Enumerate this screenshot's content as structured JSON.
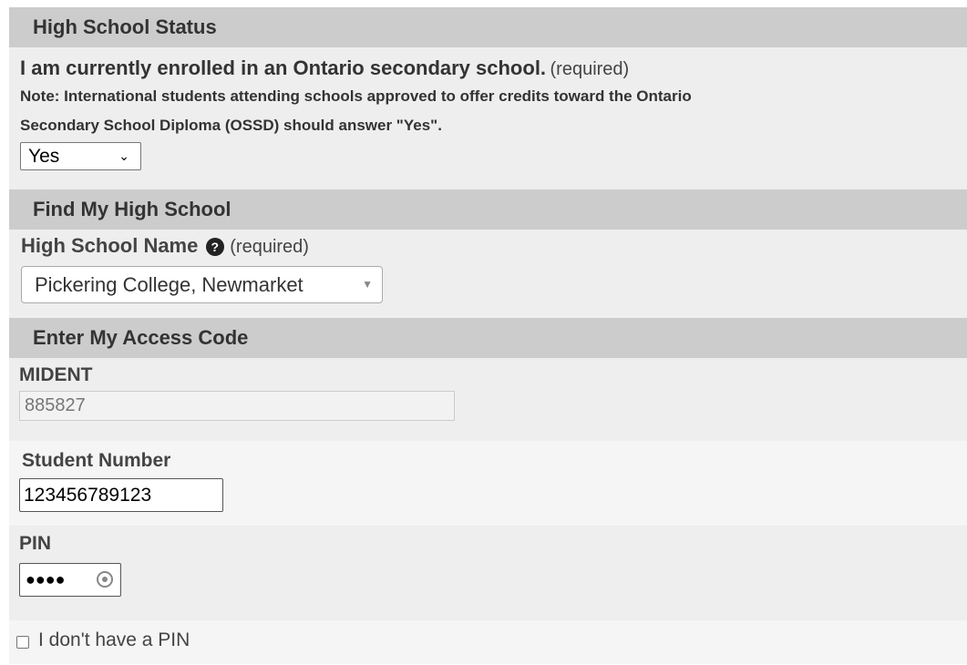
{
  "high_school_status": {
    "header": "High School Status",
    "question": "I am currently enrolled in an Ontario secondary school.",
    "required": "(required)",
    "note_line1": "Note: International students attending schools approved to offer credits toward the Ontario",
    "note_line2": "Secondary School Diploma (OSSD) should answer \"Yes\".",
    "enrolled_value": "Yes"
  },
  "find_school": {
    "header": "Find My High School",
    "label": "High School Name",
    "required": "(required)",
    "help_icon": "?",
    "selected_school": "Pickering College, Newmarket"
  },
  "access_code": {
    "header": "Enter My Access Code",
    "mident_label": "MIDENT",
    "mident_value": "885827",
    "student_number_label": "Student Number",
    "student_number_value": "123456789123",
    "pin_label": "PIN",
    "pin_masked": "●●●●",
    "no_pin_label": "I don't have a PIN"
  },
  "icons": {
    "help": "question-circle-icon",
    "dropdown": "chevron-down-icon",
    "reveal": "eye-icon"
  }
}
